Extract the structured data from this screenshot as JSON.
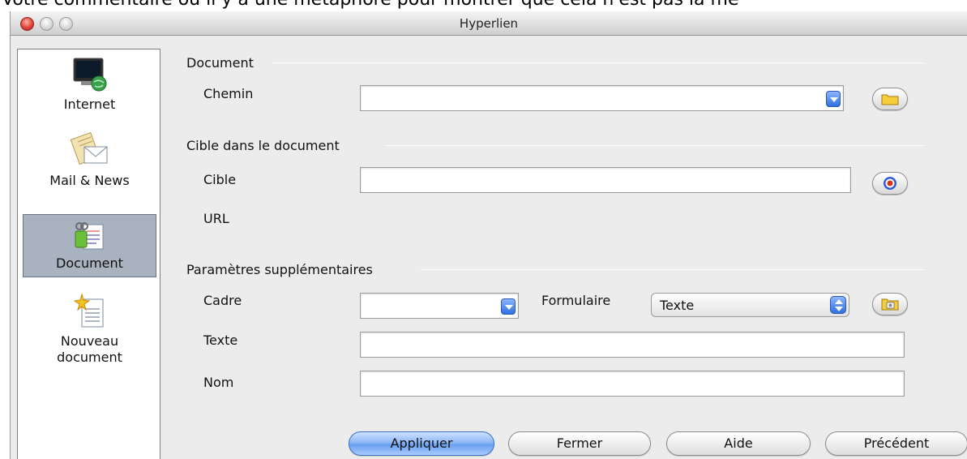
{
  "background_text": "Votre commentaire où il y a une métaphore pour montrer que cela n'est pas la mê",
  "window": {
    "title": "Hyperlien"
  },
  "sidebar": {
    "items": [
      {
        "label": "Internet",
        "icon": "internet-icon",
        "selected": false
      },
      {
        "label": "Mail & News",
        "icon": "mail-news-icon",
        "selected": false
      },
      {
        "label": "Document",
        "icon": "document-icon",
        "selected": true
      },
      {
        "label_line1": "Nouveau",
        "label_line2": "document",
        "icon": "new-document-icon",
        "selected": false
      }
    ]
  },
  "document_section": {
    "title": "Document",
    "path_label": "Chemin",
    "path_value": ""
  },
  "target_section": {
    "title": "Cible dans le document",
    "target_label": "Cible",
    "target_value": "",
    "url_label": "URL"
  },
  "additional_section": {
    "title": "Paramètres supplémentaires",
    "frame_label": "Cadre",
    "frame_value": "",
    "form_label": "Formulaire",
    "form_value": "Texte",
    "text_label": "Texte",
    "text_value": "",
    "name_label": "Nom",
    "name_value": ""
  },
  "buttons": {
    "apply": "Appliquer",
    "close": "Fermer",
    "help": "Aide",
    "back": "Précédent"
  },
  "colors": {
    "accent": "#5a94ee",
    "selected_item": "#a9b2bf",
    "window_bg": "#ececec"
  }
}
